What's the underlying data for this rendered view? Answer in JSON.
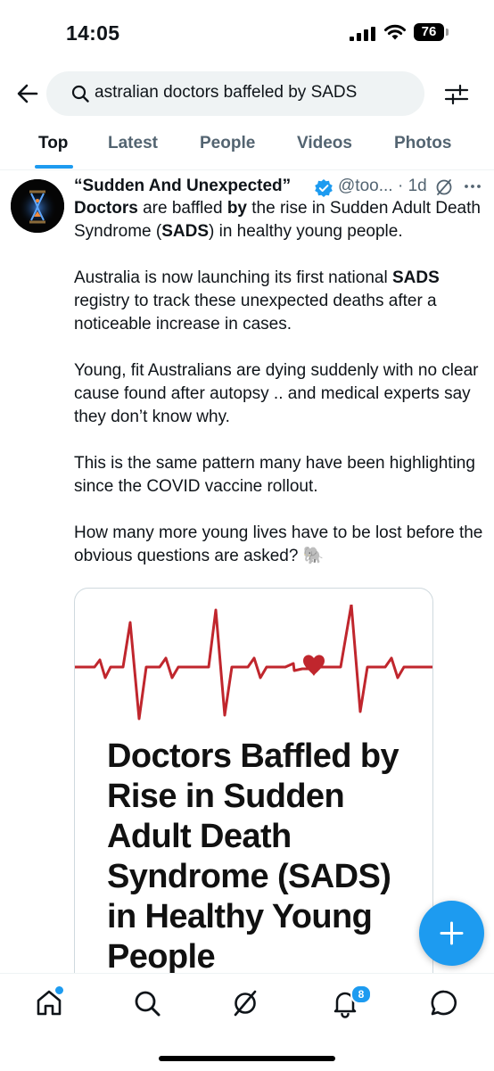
{
  "status_bar": {
    "time": "14:05",
    "battery": "76"
  },
  "search": {
    "query": "astralian doctors baffeled by SADS"
  },
  "tabs": [
    {
      "label": "Top",
      "active": true
    },
    {
      "label": "Latest"
    },
    {
      "label": "People"
    },
    {
      "label": "Videos"
    },
    {
      "label": "Photos"
    }
  ],
  "tweet": {
    "author_name": "“Sudden And Unexpected”",
    "handle": "@too...",
    "time": "· 1d",
    "p1_b1": "Doctors",
    "p1_t1": " are baffled ",
    "p1_b2": "by",
    "p1_t2": " the rise in Sudden Adult Death Syndrome (",
    "p1_b3": "SADS",
    "p1_t3": ") in healthy young people.",
    "p2_t1": "Australia is now launching its first national ",
    "p2_b1": "SADS",
    "p2_t2": " registry to track these unexpected deaths after a noticeable increase in cases.",
    "p3": "Young, fit Australians are dying suddenly with no clear cause found after autopsy .. and medical experts say they don’t know why.",
    "p4": "This is the same pattern many have been highlighting since the COVID vaccine rollout.",
    "p5": "How many more young lives have to be lost before the obvious questions are asked? 🐘",
    "media_headline": "Doctors Baffled by Rise in Sudden Adult Death Syndrome (SADS) in Healthy Young People"
  },
  "nav": {
    "notifications_badge": "8"
  },
  "colors": {
    "accent": "#1d9bf0",
    "ekg_red": "#c0262d",
    "text": "#0f1419",
    "muted": "#536471"
  },
  "icons": [
    "chevron-left-icon",
    "search-icon",
    "filter-icon",
    "verified-icon",
    "grok-icon",
    "more-icon",
    "plus-icon",
    "home-icon",
    "explore-icon",
    "grok-nav-icon",
    "bell-icon",
    "messages-icon"
  ]
}
